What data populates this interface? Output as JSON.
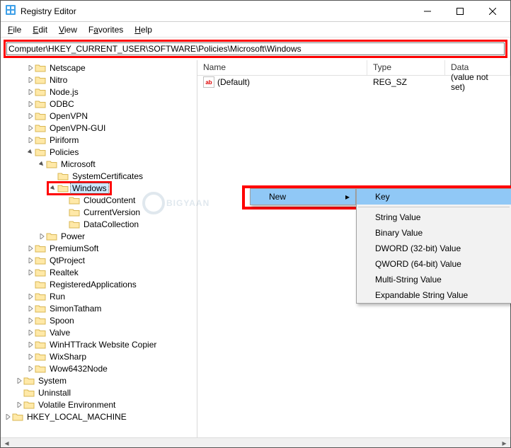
{
  "window": {
    "title": "Registry Editor"
  },
  "menu": {
    "file": "File",
    "edit": "Edit",
    "view": "View",
    "favorites": "Favorites",
    "help": "Help"
  },
  "address": {
    "path": "Computer\\HKEY_CURRENT_USER\\SOFTWARE\\Policies\\Microsoft\\Windows"
  },
  "tree": [
    {
      "level": 2,
      "exp": "closed",
      "label": "Netscape"
    },
    {
      "level": 2,
      "exp": "closed",
      "label": "Nitro"
    },
    {
      "level": 2,
      "exp": "closed",
      "label": "Node.js"
    },
    {
      "level": 2,
      "exp": "closed",
      "label": "ODBC"
    },
    {
      "level": 2,
      "exp": "closed",
      "label": "OpenVPN"
    },
    {
      "level": 2,
      "exp": "closed",
      "label": "OpenVPN-GUI"
    },
    {
      "level": 2,
      "exp": "closed",
      "label": "Piriform"
    },
    {
      "level": 2,
      "exp": "open",
      "label": "Policies"
    },
    {
      "level": 3,
      "exp": "open",
      "label": "Microsoft"
    },
    {
      "level": 4,
      "exp": "none",
      "label": "SystemCertificates"
    },
    {
      "level": 4,
      "exp": "open",
      "label": "Windows",
      "selected": true,
      "redbox": true
    },
    {
      "level": 5,
      "exp": "none",
      "label": "CloudContent"
    },
    {
      "level": 5,
      "exp": "none",
      "label": "CurrentVersion"
    },
    {
      "level": 5,
      "exp": "none",
      "label": "DataCollection"
    },
    {
      "level": 3,
      "exp": "closed",
      "label": "Power"
    },
    {
      "level": 2,
      "exp": "closed",
      "label": "PremiumSoft"
    },
    {
      "level": 2,
      "exp": "closed",
      "label": "QtProject"
    },
    {
      "level": 2,
      "exp": "closed",
      "label": "Realtek"
    },
    {
      "level": 2,
      "exp": "none",
      "label": "RegisteredApplications"
    },
    {
      "level": 2,
      "exp": "closed",
      "label": "Run"
    },
    {
      "level": 2,
      "exp": "closed",
      "label": "SimonTatham"
    },
    {
      "level": 2,
      "exp": "closed",
      "label": "Spoon"
    },
    {
      "level": 2,
      "exp": "closed",
      "label": "Valve"
    },
    {
      "level": 2,
      "exp": "closed",
      "label": "WinHTTrack Website Copier"
    },
    {
      "level": 2,
      "exp": "closed",
      "label": "WixSharp"
    },
    {
      "level": 2,
      "exp": "closed",
      "label": "Wow6432Node"
    },
    {
      "level": 1,
      "exp": "closed",
      "label": "System"
    },
    {
      "level": 1,
      "exp": "none",
      "label": "Uninstall"
    },
    {
      "level": 1,
      "exp": "closed",
      "label": "Volatile Environment"
    },
    {
      "level": 0,
      "exp": "closed",
      "label": "HKEY_LOCAL_MACHINE"
    }
  ],
  "list": {
    "headers": {
      "name": "Name",
      "type": "Type",
      "data": "Data"
    },
    "rows": [
      {
        "name": "(Default)",
        "type": "REG_SZ",
        "data": "(value not set)"
      }
    ]
  },
  "context_root": {
    "new": "New"
  },
  "context_sub": {
    "key": "Key",
    "string": "String Value",
    "binary": "Binary Value",
    "dword": "DWORD (32-bit) Value",
    "qword": "QWORD (64-bit) Value",
    "multi": "Multi-String Value",
    "expand": "Expandable String Value"
  },
  "watermark": "BIGYAAN"
}
